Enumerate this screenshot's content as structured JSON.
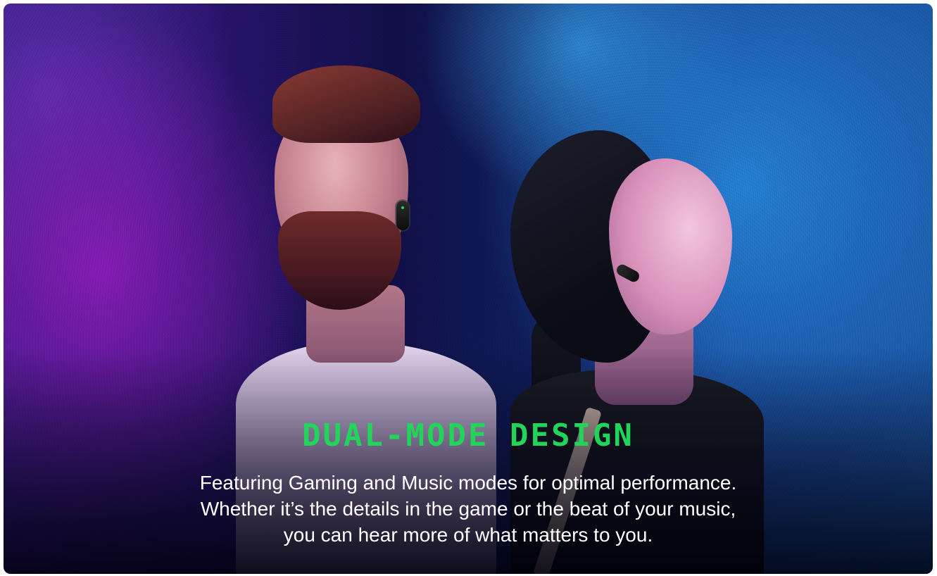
{
  "banner": {
    "headline": "DUAL-MODE DESIGN",
    "body_lines": [
      "Featuring Gaming and Music modes for optimal performance.",
      "Whether it’s the details in the game or the beat of your music,",
      "you can hear more of what matters to you."
    ]
  },
  "colors": {
    "accent": "#22d45a",
    "text": "#ffffff"
  }
}
